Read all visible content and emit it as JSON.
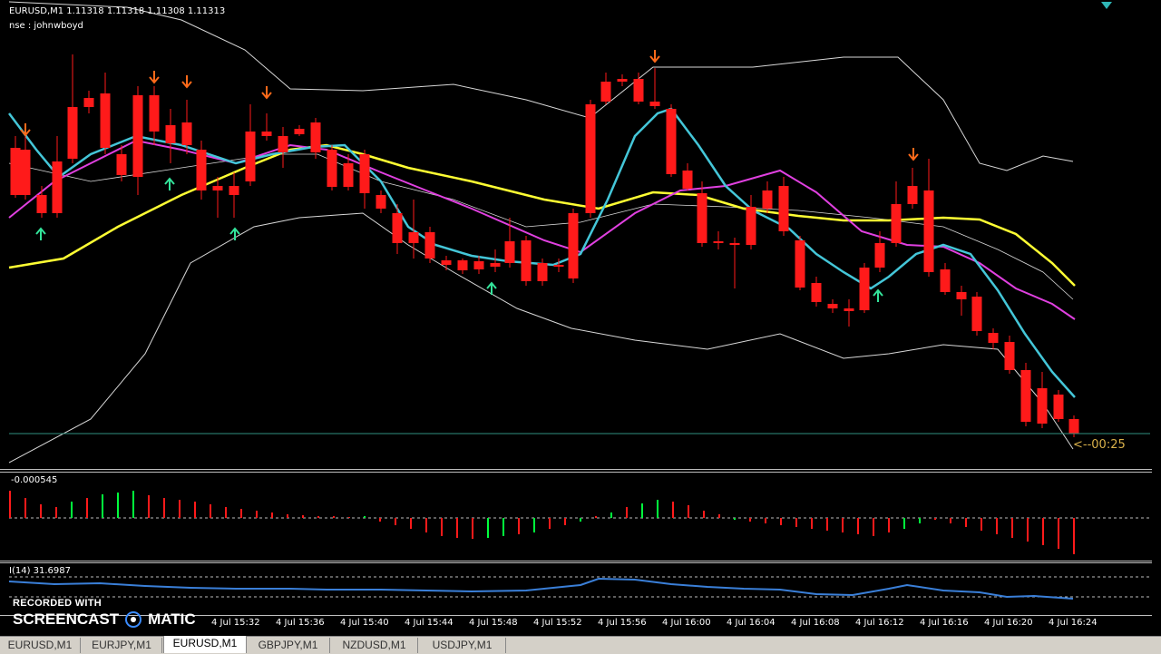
{
  "header": {
    "title": "EURUSD,M1  1.11318 1.11318 1.11308 1.11313",
    "subtitle": "nse : johnwboyd"
  },
  "price_label": "<--00:25",
  "oscillator": {
    "label": "-0.000545"
  },
  "rsi": {
    "label": "I(14) 31.6987"
  },
  "time_axis": [
    "4 Jul 15:32",
    "4 Jul 15:36",
    "4 Jul 15:40",
    "4 Jul 15:44",
    "4 Jul 15:48",
    "4 Jul 15:52",
    "4 Jul 15:56",
    "4 Jul 16:00",
    "4 Jul 16:04",
    "4 Jul 16:08",
    "4 Jul 16:12",
    "4 Jul 16:16",
    "4 Jul 16:20",
    "4 Jul 16:24"
  ],
  "tabs": [
    {
      "label": "EURUSD,M1",
      "active": false
    },
    {
      "label": "EURJPY,M1",
      "active": false
    },
    {
      "label": "EURUSD,M1",
      "active": true
    },
    {
      "label": "GBPJPY,M1",
      "active": false
    },
    {
      "label": "NZDUSD,M1",
      "active": false
    },
    {
      "label": "USDJPY,M1",
      "active": false
    }
  ],
  "watermark": {
    "line1": "RECORDED WITH",
    "line2a": "SCREENCAST",
    "line2b": "MATIC"
  },
  "colors": {
    "bull": "#00ff3c",
    "bear": "#ff1a1a",
    "ema_fast": "#44c6d8",
    "ema_mid": "#e040e0",
    "ema_slow": "#ffff33",
    "band": "#d8d8d8",
    "arrow_down": "#ff6a1a",
    "arrow_up": "#33e39a",
    "rsi": "#3a7fd8"
  }
}
